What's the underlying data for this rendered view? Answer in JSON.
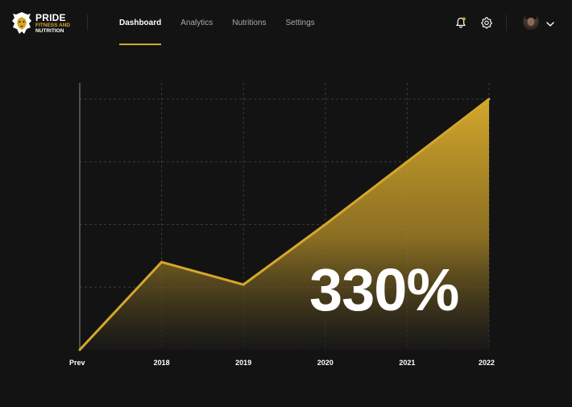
{
  "brand": {
    "title": "PRIDE",
    "subtitle_line1": "FITNESS AND",
    "subtitle_line2": "NUTRITION",
    "accent_color": "#d4a72c",
    "logo_icon": "lion-icon"
  },
  "nav": {
    "items": [
      {
        "label": "Dashboard",
        "active": true
      },
      {
        "label": "Analytics",
        "active": false
      },
      {
        "label": "Nutritions",
        "active": false
      },
      {
        "label": "Settings",
        "active": false
      }
    ]
  },
  "header_icons": {
    "notification": "bell-icon",
    "settings": "gear-icon",
    "menu": "chevron-down-icon"
  },
  "highlight": {
    "value": "330%"
  },
  "chart_data": {
    "type": "area",
    "categories": [
      "Prev",
      "2018",
      "2019",
      "2020",
      "2021",
      "2022"
    ],
    "values": [
      0,
      35,
      26,
      50,
      75,
      100
    ],
    "ylim": [
      0,
      100
    ],
    "grid": true,
    "series_color": "#d4a72c",
    "title": "",
    "xlabel": "",
    "ylabel": ""
  }
}
